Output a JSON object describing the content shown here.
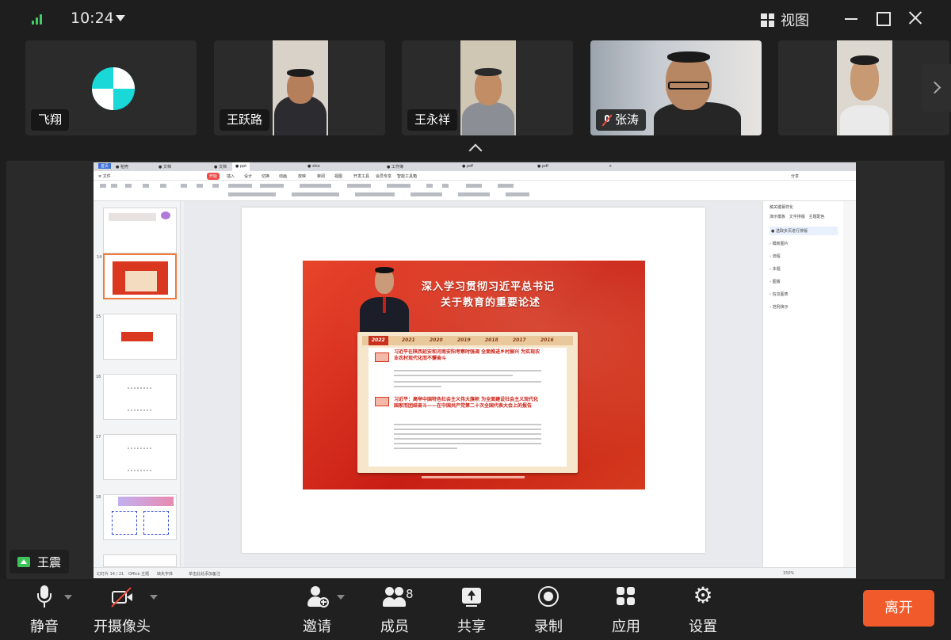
{
  "status": {
    "time": "10:24"
  },
  "window": {
    "view_label": "视图"
  },
  "participants": [
    {
      "name": "飞翔"
    },
    {
      "name": "王跃路"
    },
    {
      "name": "王永祥"
    },
    {
      "name": "张涛",
      "muted": true
    },
    {
      "name": ""
    }
  ],
  "speaker": {
    "name": "王震"
  },
  "shared": {
    "slide_title_1": "深入学习贯彻习近平总书记",
    "slide_title_2": "关于教育的重要论述",
    "years": [
      "2022",
      "2021",
      "2020",
      "2019",
      "2018",
      "2017",
      "2016"
    ],
    "headline_1": "习近平在陕西延安和河南安阳考察时强调 全面推进乡村振兴 为实现农业农村现代化而不懈奋斗",
    "headline_2": "习近平：高举中国特色社会主义伟大旗帜 为全面建设社会主义现代化国家而团结奋斗——在中国共产党第二十次全国代表大会上的报告"
  },
  "toolbar": {
    "mute": "静音",
    "camera": "开摄像头",
    "invite": "邀请",
    "members": "成员",
    "members_count": "8",
    "share": "共享",
    "record": "录制",
    "apps": "应用",
    "settings": "设置",
    "leave": "离开"
  },
  "colors": {
    "accent": "#f15a2b",
    "signal": "#3fcf63",
    "active_share": "#3ec35a"
  }
}
